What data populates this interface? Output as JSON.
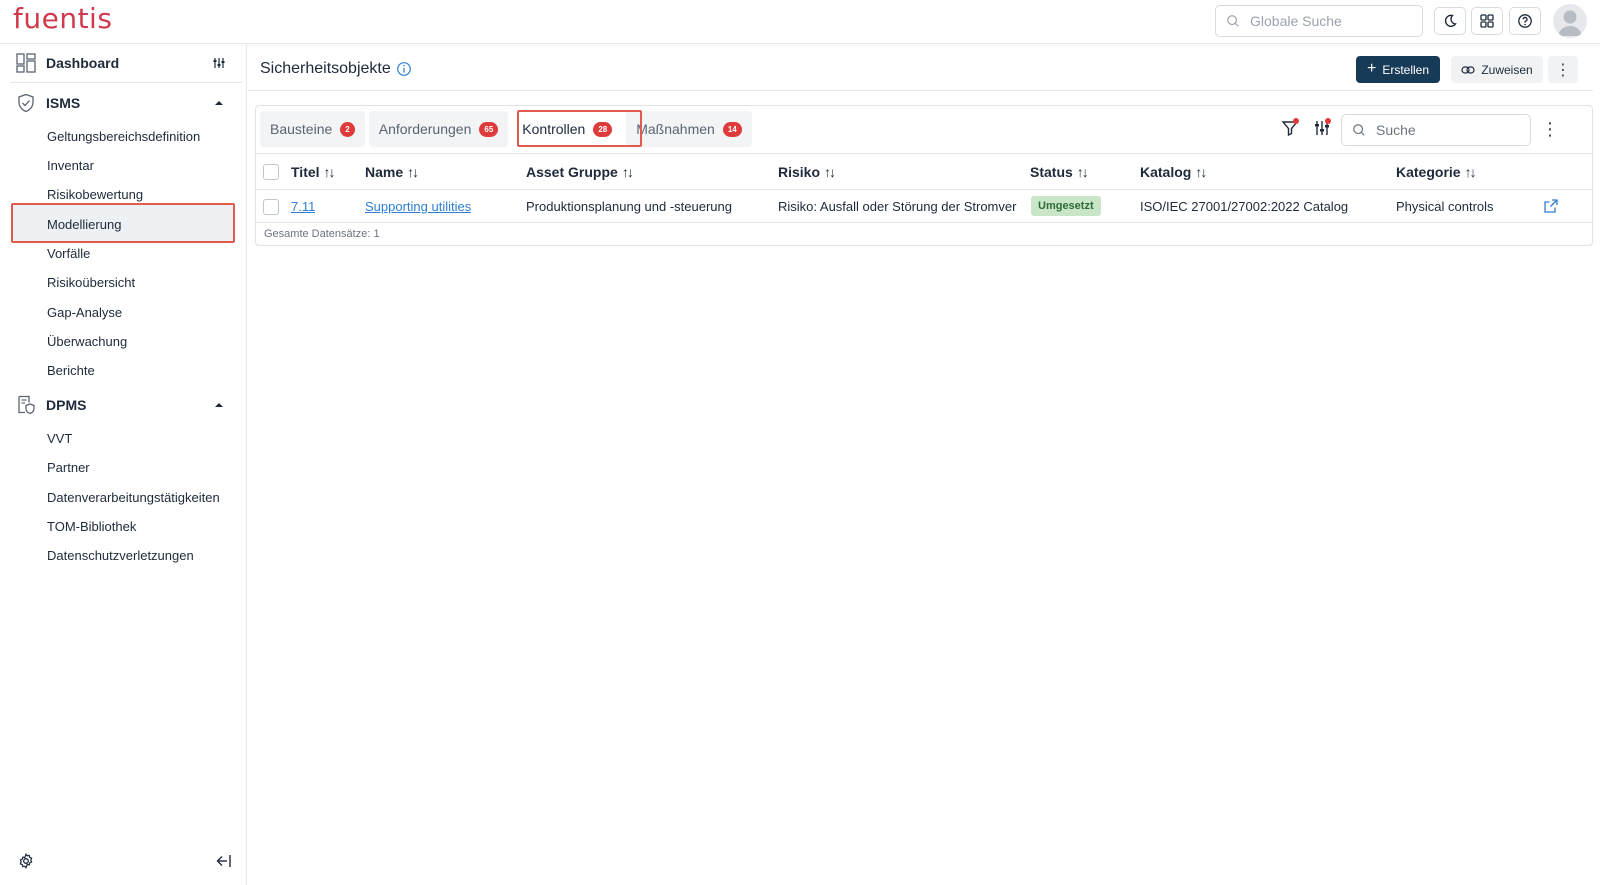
{
  "app": {
    "logo": "fuentis",
    "global_search_placeholder": "Globale Suche"
  },
  "sidebar": {
    "dashboard_label": "Dashboard",
    "isms": {
      "label": "ISMS",
      "items": [
        "Geltungsbereichsdefinition",
        "Inventar",
        "Risikobewertung",
        "Modellierung",
        "Vorfälle",
        "Risikoübersicht",
        "Gap-Analyse",
        "Überwachung",
        "Berichte"
      ],
      "active_item": "Modellierung"
    },
    "dpms": {
      "label": "DPMS",
      "items": [
        "VVT",
        "Partner",
        "Datenverarbeitungstätigkeiten",
        "TOM-Bibliothek",
        "Datenschutzverletzungen"
      ]
    }
  },
  "page": {
    "title": "Sicherheitsobjekte",
    "create_label": "Erstellen",
    "assign_label": "Zuweisen"
  },
  "tabs": [
    {
      "label": "Bausteine",
      "count": "2"
    },
    {
      "label": "Anforderungen",
      "count": "65"
    },
    {
      "label": "Kontrollen",
      "count": "28"
    },
    {
      "label": "Maßnahmen",
      "count": "14"
    }
  ],
  "active_tab": "Kontrollen",
  "search_placeholder": "Suche",
  "table": {
    "columns": [
      "Titel",
      "Name",
      "Asset Gruppe",
      "Risiko",
      "Status",
      "Katalog",
      "Kategorie"
    ],
    "rows": [
      {
        "titel": "7.11",
        "name": "Supporting utilities",
        "asset_gruppe": "Produktionsplanung und -steuerung",
        "risiko": "Risiko: Ausfall oder Störung der Stromver",
        "status": "Umgesetzt",
        "katalog": "ISO/IEC 27001/27002:2022 Catalog",
        "kategorie": "Physical controls"
      }
    ],
    "footer": "Gesamte Datensätze: 1"
  },
  "colors": {
    "brand": "#d13a4c",
    "primary_button": "#173a57",
    "badge": "#e03b3b",
    "highlight_box": "#e05a4e",
    "link": "#2e7ed3",
    "status_bg": "#c9e6c8"
  }
}
